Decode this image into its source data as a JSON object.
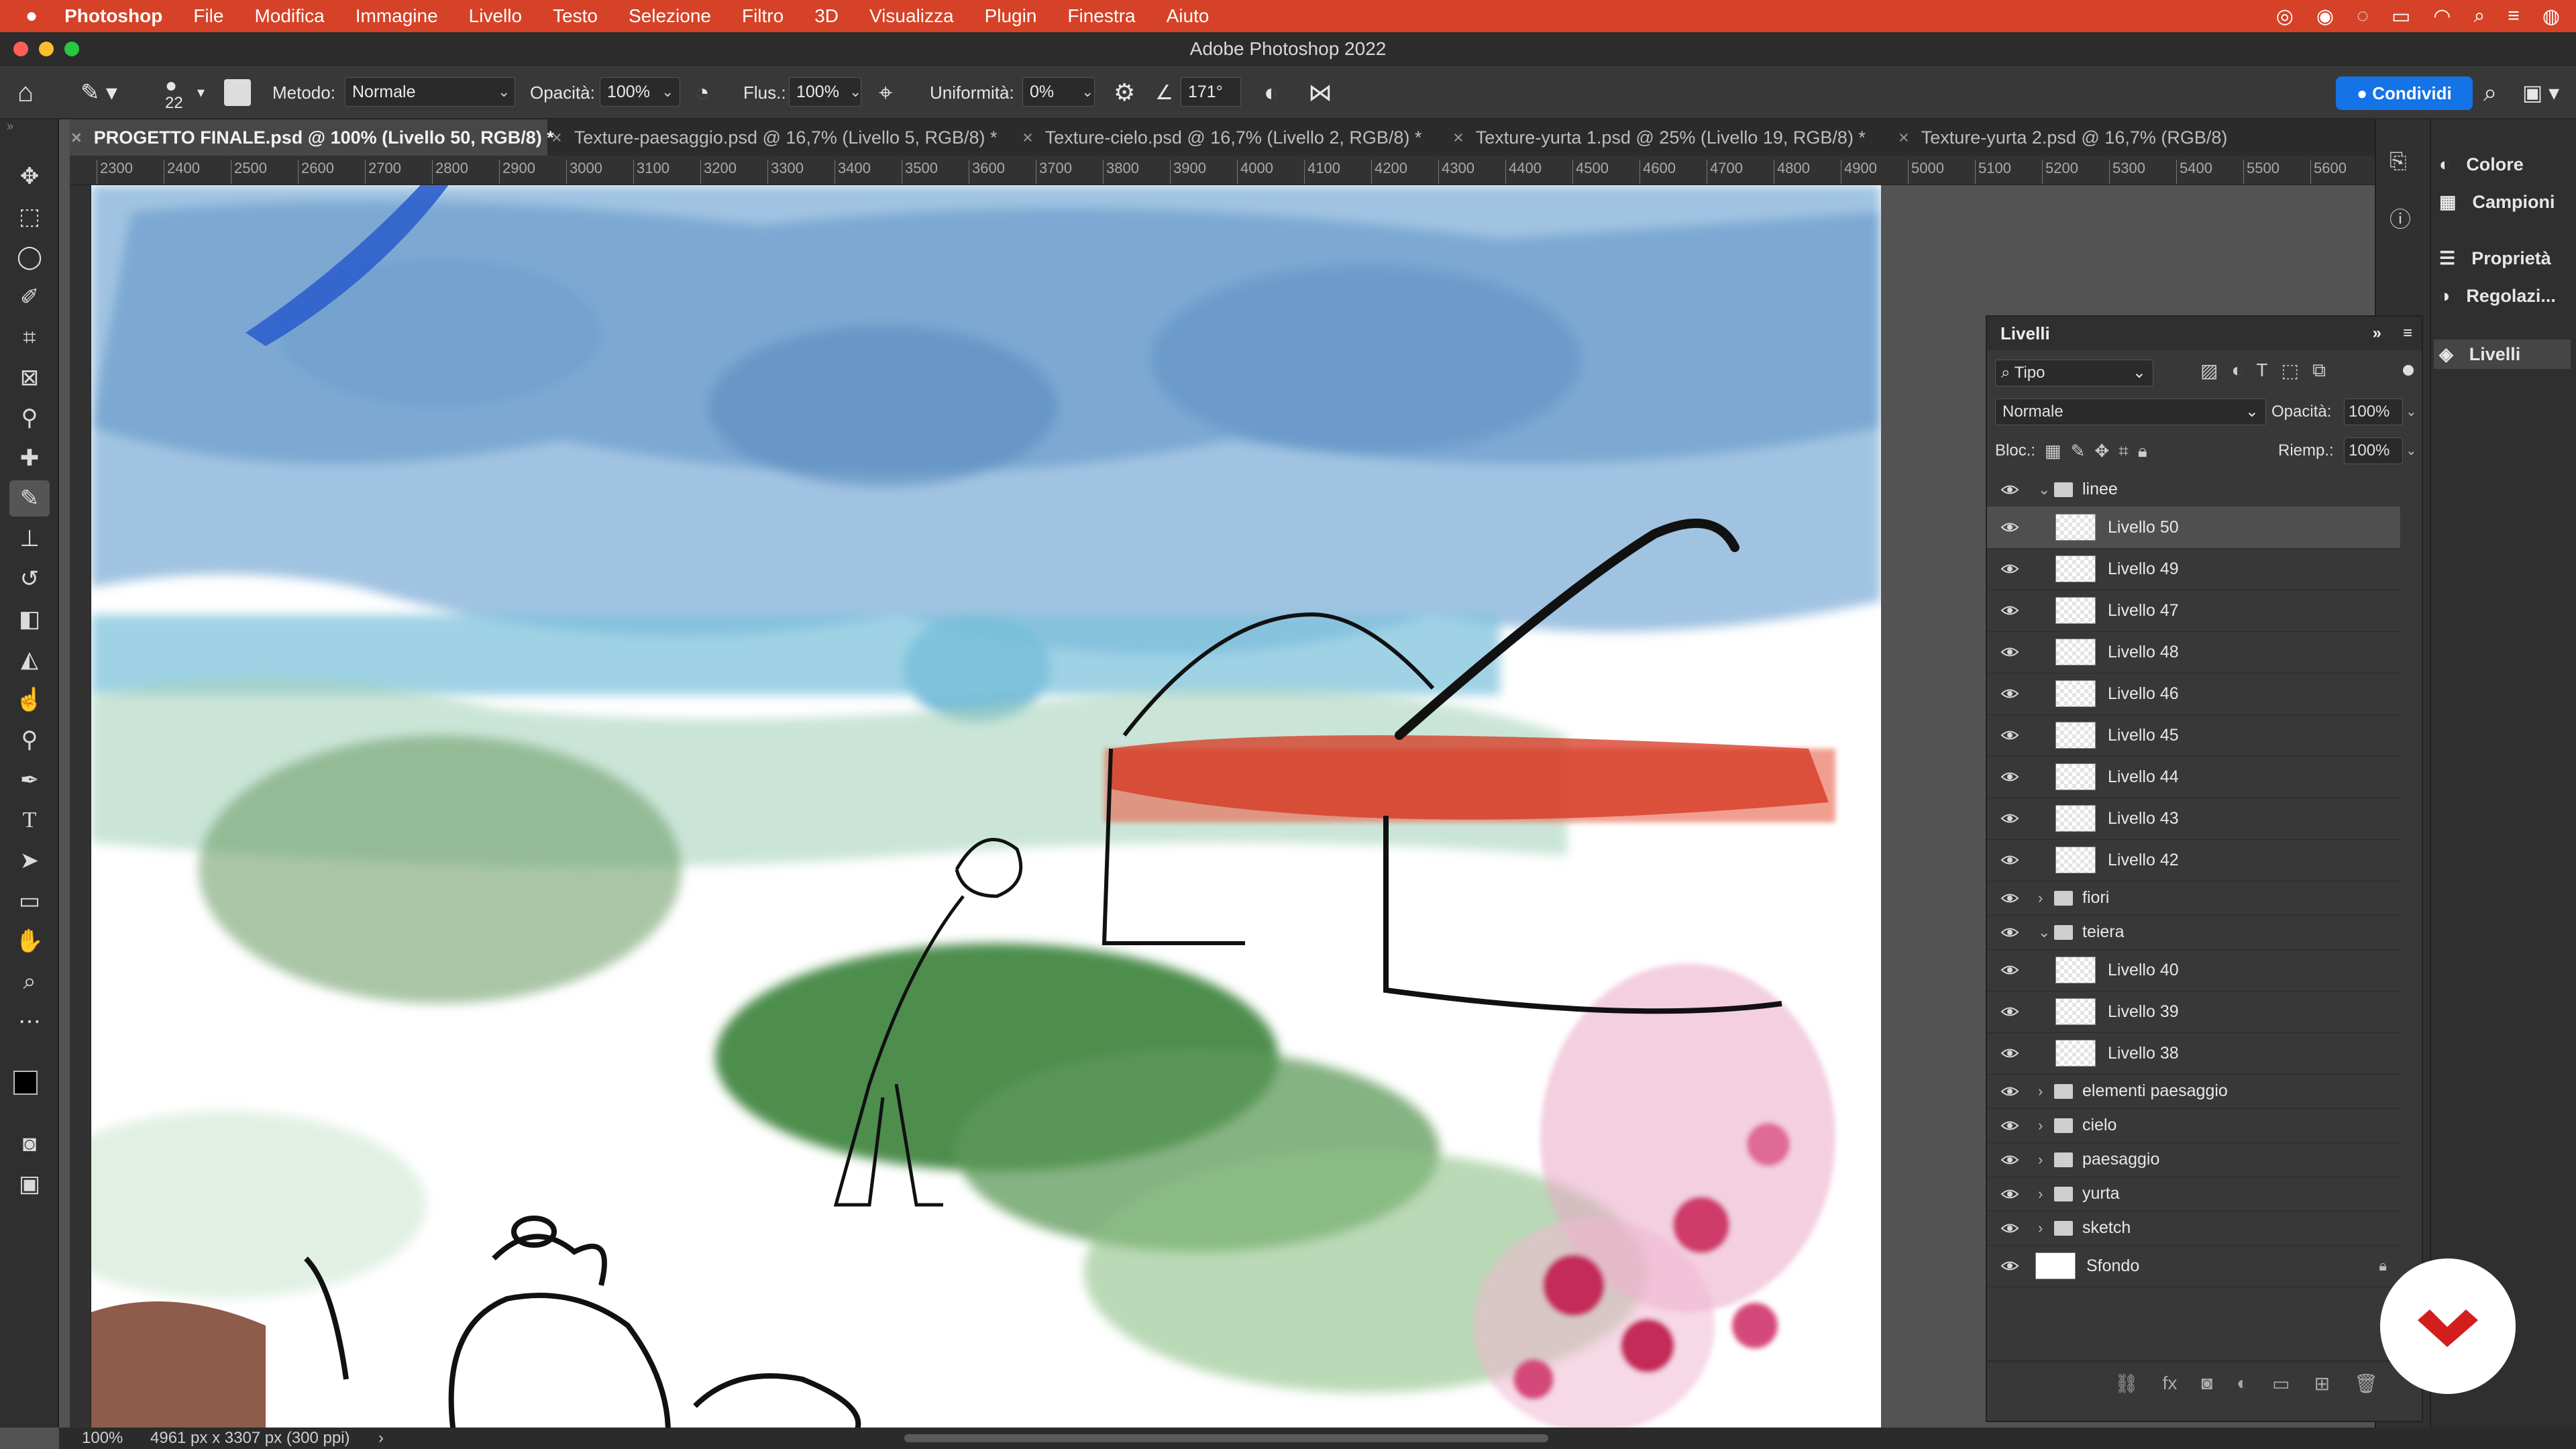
{
  "menubar": {
    "apple": "",
    "app": "Photoshop",
    "items": [
      "File",
      "Modifica",
      "Immagine",
      "Livello",
      "Testo",
      "Selezione",
      "Filtro",
      "3D",
      "Visualizza",
      "Plugin",
      "Finestra",
      "Aiuto"
    ]
  },
  "window": {
    "title": "Adobe Photoshop 2022"
  },
  "options": {
    "brush_size": "22",
    "metodo_label": "Metodo:",
    "metodo_value": "Normale",
    "opacita_label": "Opacità:",
    "opacita_value": "100%",
    "flus_label": "Flus.:",
    "flus_value": "100%",
    "uniformita_label": "Uniformità:",
    "uniformita_value": "0%",
    "angle_value": "171°",
    "share_label": "Condividi"
  },
  "tabs": [
    {
      "label": "PROGETTO FINALE.psd @ 100% (Livello 50, RGB/8) *",
      "active": true
    },
    {
      "label": "Texture-paesaggio.psd @ 16,7% (Livello 5, RGB/8) *",
      "active": false
    },
    {
      "label": "Texture-cielo.psd @ 16,7% (Livello 2, RGB/8) *",
      "active": false
    },
    {
      "label": "Texture-yurta 1.psd @ 25% (Livello 19, RGB/8) *",
      "active": false
    },
    {
      "label": "Texture-yurta 2.psd @ 16,7% (RGB/8)",
      "active": false
    }
  ],
  "ruler": {
    "ticks": [
      "2300",
      "2400",
      "2500",
      "2600",
      "2700",
      "2800",
      "2900",
      "3000",
      "3100",
      "3200",
      "3300",
      "3400",
      "3500",
      "3600",
      "3700",
      "3800",
      "3900",
      "4000",
      "4100",
      "4200",
      "4300",
      "4400",
      "4500",
      "4600",
      "4700",
      "4800",
      "4900",
      "5000",
      "5100",
      "5200",
      "5300",
      "5400",
      "5500",
      "5600"
    ]
  },
  "dock": {
    "items": [
      "Colore",
      "Campioni",
      "Proprietà",
      "Regolazi...",
      "Livelli"
    ]
  },
  "layers_panel": {
    "title": "Livelli",
    "filter_label": "Tipo",
    "blend_mode": "Normale",
    "opacity_label": "Opacità:",
    "opacity_value": "100%",
    "lock_label": "Bloc.:",
    "fill_label": "Riemp.:",
    "fill_value": "100%",
    "rows": [
      {
        "name": "linee",
        "type": "group",
        "open": true,
        "indent": 0
      },
      {
        "name": "Livello 50",
        "type": "layer",
        "indent": 1,
        "selected": true
      },
      {
        "name": "Livello 49",
        "type": "layer",
        "indent": 1
      },
      {
        "name": "Livello 47",
        "type": "layer",
        "indent": 1
      },
      {
        "name": "Livello 48",
        "type": "layer",
        "indent": 1
      },
      {
        "name": "Livello 46",
        "type": "layer",
        "indent": 1
      },
      {
        "name": "Livello 45",
        "type": "layer",
        "indent": 1
      },
      {
        "name": "Livello 44",
        "type": "layer",
        "indent": 1
      },
      {
        "name": "Livello 43",
        "type": "layer",
        "indent": 1
      },
      {
        "name": "Livello 42",
        "type": "layer",
        "indent": 1
      },
      {
        "name": "fiori",
        "type": "group",
        "open": false,
        "indent": 0
      },
      {
        "name": "teiera",
        "type": "group",
        "open": true,
        "indent": 0
      },
      {
        "name": "Livello 40",
        "type": "layer",
        "indent": 1
      },
      {
        "name": "Livello 39",
        "type": "layer",
        "indent": 1
      },
      {
        "name": "Livello 38",
        "type": "layer",
        "indent": 1
      },
      {
        "name": "elementi paesaggio",
        "type": "group",
        "open": false,
        "indent": 0
      },
      {
        "name": "cielo",
        "type": "group",
        "open": false,
        "indent": 0
      },
      {
        "name": "paesaggio",
        "type": "group",
        "open": false,
        "indent": 0
      },
      {
        "name": "yurta",
        "type": "group",
        "open": false,
        "indent": 0
      },
      {
        "name": "sketch",
        "type": "group",
        "open": false,
        "indent": 0
      },
      {
        "name": "Sfondo",
        "type": "background",
        "indent": 0
      }
    ]
  },
  "status": {
    "zoom": "100%",
    "doc_info": "4961 px x 3307 px (300 ppi)"
  },
  "colors": {
    "menubar": "#d64227",
    "accent": "#1473e6",
    "brand_badge": "#d31e1e"
  }
}
